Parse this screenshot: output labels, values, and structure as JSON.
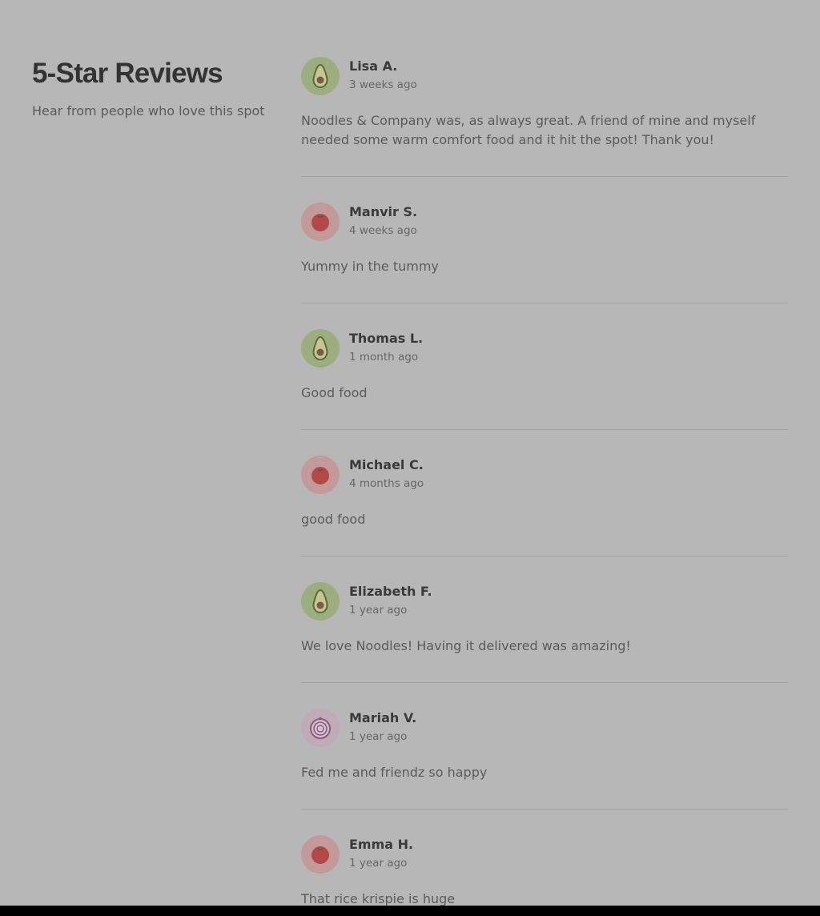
{
  "section": {
    "title": "5-Star Reviews",
    "subtitle": "Hear from people who love this spot"
  },
  "reviews": [
    {
      "name": "Lisa A.",
      "date": "3 weeks ago",
      "text": "Noodles & Company was, as always great. A friend of mine and myself needed some warm comfort food and it hit the spot! Thank you!",
      "avatar": "avocado-icon"
    },
    {
      "name": "Manvir S.",
      "date": "4 weeks ago",
      "text": "Yummy in the tummy",
      "avatar": "tomato-icon"
    },
    {
      "name": "Thomas L.",
      "date": "1 month ago",
      "text": "Good food",
      "avatar": "avocado-icon"
    },
    {
      "name": "Michael C.",
      "date": "4 months ago",
      "text": "good food",
      "avatar": "tomato-icon"
    },
    {
      "name": "Elizabeth F.",
      "date": "1 year ago",
      "text": "We love Noodles! Having it delivered was amazing!",
      "avatar": "avocado-icon"
    },
    {
      "name": "Mariah V.",
      "date": "1 year ago",
      "text": "Fed me and friendz so happy",
      "avatar": "onion-icon"
    },
    {
      "name": "Emma H.",
      "date": "1 year ago",
      "text": "That rice krispie is huge",
      "avatar": "tomato-icon"
    }
  ],
  "colors": {
    "overlay_background": "#b7b7b7",
    "avocado_bg": "#9cad80",
    "tomato_bg": "#c39a9a",
    "onion_bg": "#bfaab8"
  }
}
